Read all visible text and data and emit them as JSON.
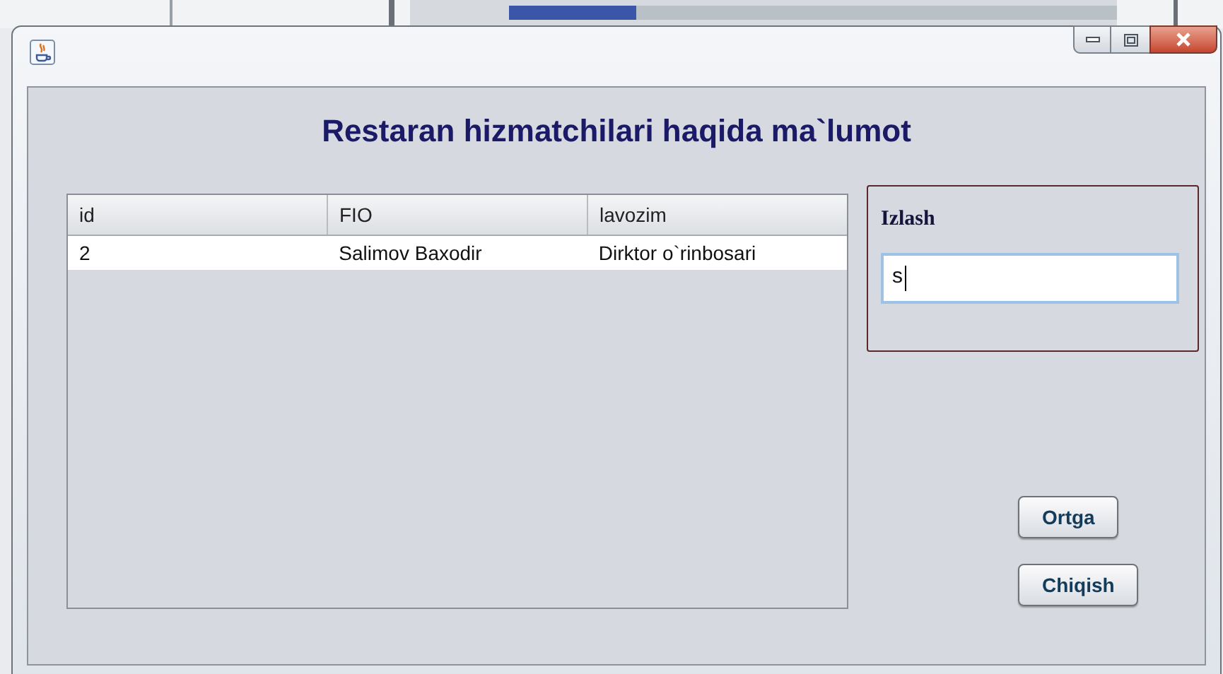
{
  "window": {
    "heading": "Restaran hizmatchilari haqida ma`lumot"
  },
  "table": {
    "columns": [
      "id",
      "FIO",
      "lavozim"
    ],
    "rows": [
      {
        "cells": [
          "2",
          "Salimov Baxodir",
          "Dirktor o`rinbosari"
        ],
        "selected": false
      }
    ]
  },
  "search": {
    "title": "Izlash",
    "value": "s",
    "focused": true
  },
  "buttons": [
    "Ortga",
    "Chiqish"
  ]
}
